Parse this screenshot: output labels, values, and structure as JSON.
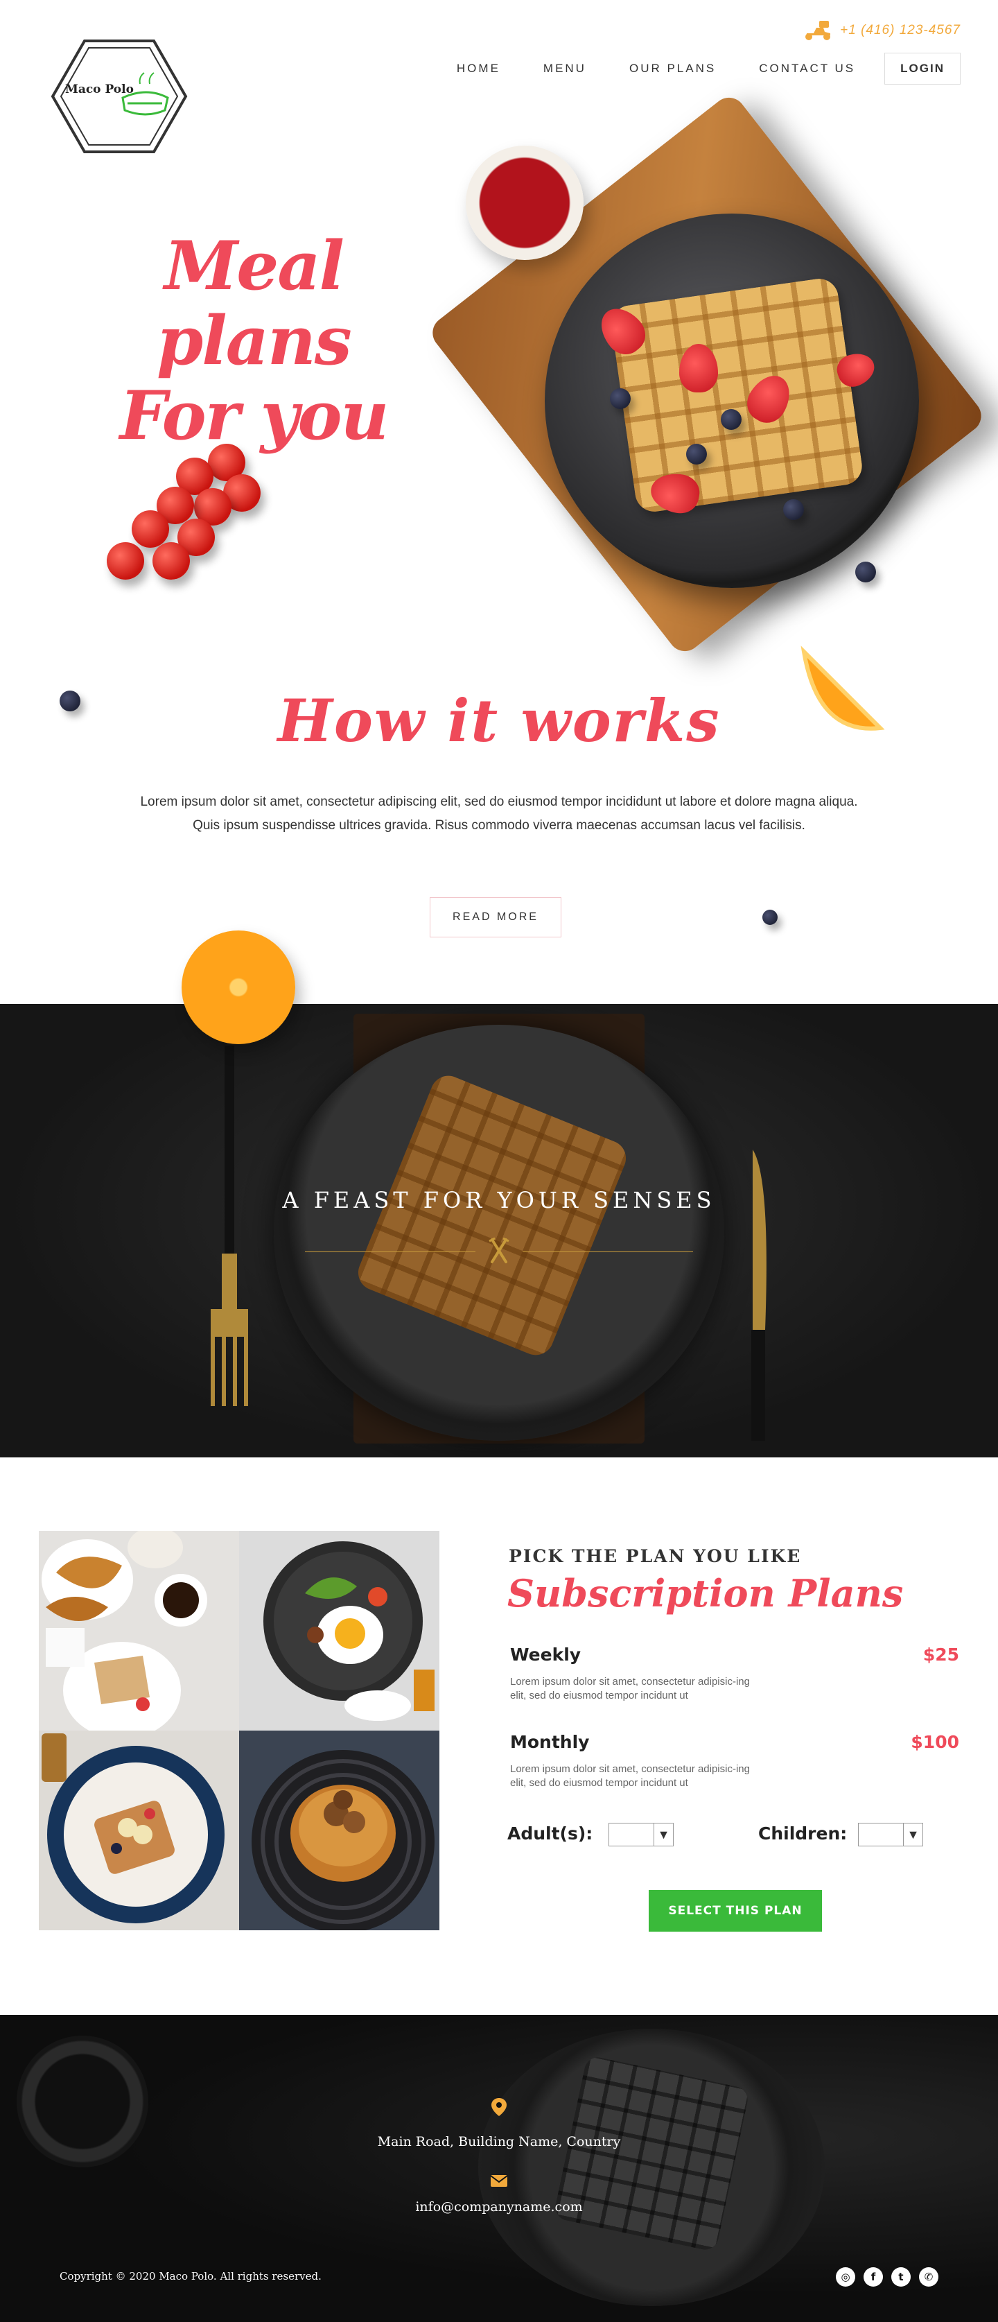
{
  "header": {
    "phone": "+1 (416) 123-4567",
    "logo_text": "Maco Polo",
    "nav": [
      "HOME",
      "MENU",
      "OUR PLANS",
      "CONTACT US"
    ],
    "login": "LOGIN"
  },
  "hero": {
    "title_line1": "Meal plans",
    "title_line2": "For you"
  },
  "how": {
    "title": "How it works",
    "text": "Lorem ipsum dolor sit amet, consectetur adipiscing elit, sed do eiusmod tempor incididunt ut labore et dolore magna aliqua. Quis ipsum suspendisse ultrices gravida. Risus commodo viverra maecenas accumsan lacus vel facilisis.",
    "button": "READ MORE"
  },
  "feast": {
    "title": "A FEAST FOR YOUR SENSES"
  },
  "plans": {
    "kicker": "PICK THE PLAN YOU LIKE",
    "title": "Subscription Plans",
    "items": [
      {
        "name": "Weekly",
        "price": "$25",
        "desc": "Lorem ipsum dolor sit amet, consectetur adipisic-ing elit, sed do eiusmod tempor incidunt ut"
      },
      {
        "name": "Monthly",
        "price": "$100",
        "desc": "Lorem ipsum dolor sit amet, consectetur adipisic-ing elit, sed do eiusmod tempor incidunt ut"
      }
    ],
    "adults_label": "Adult(s):",
    "children_label": "Children:",
    "adults_value": "",
    "children_value": "",
    "button": "SELECT THIS PLAN",
    "button_color": "#3aba3a"
  },
  "footer": {
    "address": "Main Road, Building Name, Country",
    "email": "info@companyname.com",
    "copyright": "Copyright © 2020 Maco Polo. All rights reserved.",
    "socials": [
      "instagram-icon",
      "facebook-icon",
      "twitter-icon",
      "whatsapp-icon"
    ],
    "accent": "#f2a93b"
  },
  "colors": {
    "accent_red": "#ef4a5a",
    "accent_orange": "#f2a93b",
    "gold_line": "#c79a3b"
  }
}
